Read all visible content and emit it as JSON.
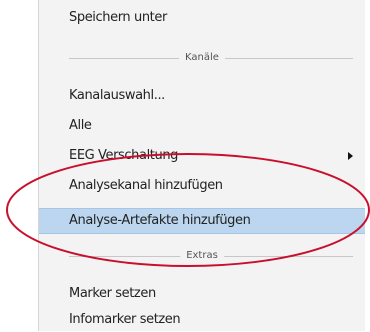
{
  "menu": {
    "save_as": "Speichern unter",
    "section_channels": "Kanäle",
    "channel_selection": "Kanalauswahl...",
    "all": "Alle",
    "eeg_montage": "EEG Verschaltung",
    "add_analysis_channel": "Analysekanal hinzufügen",
    "add_analysis_artifacts": "Analyse-Artefakte hinzufügen",
    "section_extras": "Extras",
    "set_marker": "Marker setzen",
    "set_info_marker": "Infomarker setzen"
  },
  "colors": {
    "highlight": "#bcd6ef",
    "annotation_ellipse": "#c8102e"
  }
}
